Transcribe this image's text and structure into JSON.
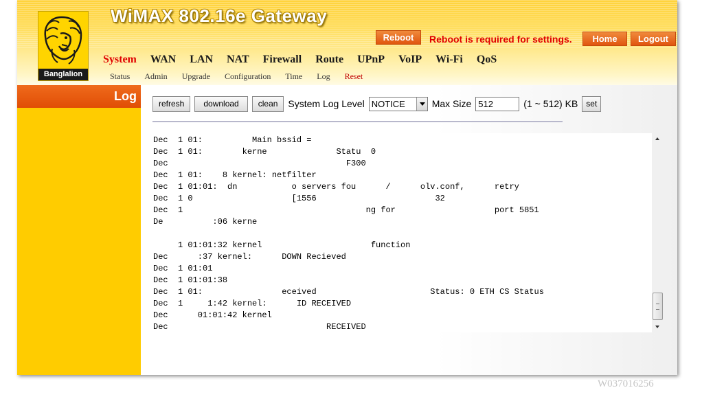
{
  "header": {
    "title": "WiMAX 802.16e Gateway",
    "logo_text": "Banglalion",
    "reboot_label": "Reboot",
    "reboot_message": "Reboot is required for settings.",
    "home_label": "Home",
    "logout_label": "Logout"
  },
  "nav": {
    "main": [
      "System",
      "WAN",
      "LAN",
      "NAT",
      "Firewall",
      "Route",
      "UPnP",
      "VoIP",
      "Wi-Fi",
      "QoS"
    ],
    "active_main": "System",
    "sub": [
      "Status",
      "Admin",
      "Upgrade",
      "Configuration",
      "Time",
      "Log",
      "Reset"
    ],
    "active_sub": "Reset"
  },
  "sidebar": {
    "title": "Log"
  },
  "toolbar": {
    "refresh_label": "refresh",
    "download_label": "download",
    "clean_label": "clean",
    "level_label": "System Log Level",
    "level_value": "NOTICE",
    "maxsize_label": "Max Size",
    "maxsize_value": "512",
    "range_label": "(1 ~ 512) KB",
    "set_label": "set"
  },
  "log": {
    "lines": [
      "Dec  1 01:          Main bssid =",
      "Dec  1 01:        kerne              Statu  0",
      "Dec                                    F300",
      "Dec  1 01:    8 kernel: netfilter",
      "Dec  1 01:01:  dn           o servers fou      /      olv.conf,      retry",
      "Dec  1 0                    [1556                        32",
      "Dec  1                                     ng for                    port 5851",
      "De          :06 kerne",
      "",
      "     1 01:01:32 kernel                      function",
      "Dec      :37 kernel:      DOWN Recieved",
      "Dec  1 01:01",
      "Dec  1 01:01:38",
      "Dec  1 01:                eceived                       Status: 0 ETH CS Status",
      "Dec  1     1:42 kernel:      ID RECEIVED",
      "Dec      01:01:42 kernel",
      "Dec                                RECEIVED"
    ]
  },
  "watermark": "W037016256",
  "colors": {
    "accent": "#e04e05",
    "sidebar": "#ffcc00",
    "header": "#ffd23a",
    "alert": "#e00000"
  }
}
